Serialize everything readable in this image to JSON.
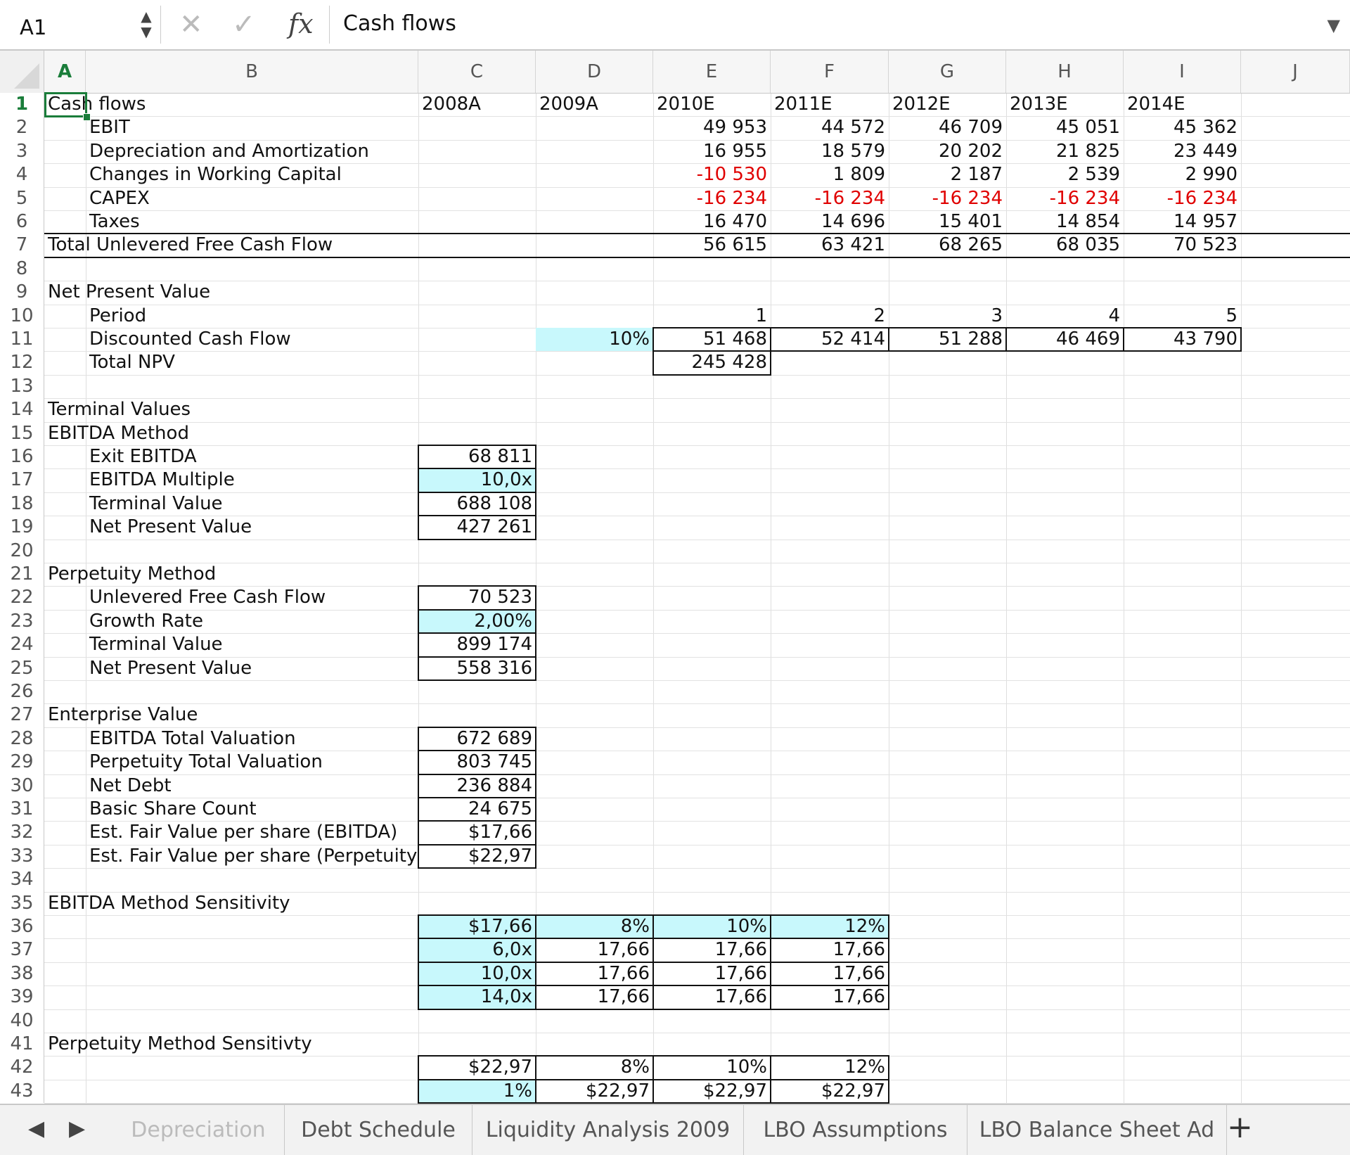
{
  "formula_bar": {
    "cell_ref": "A1",
    "stepper_up": "▲",
    "stepper_down": "▼",
    "cancel_glyph": "✕",
    "enter_glyph": "✓",
    "fx_label": "fx",
    "content": "Cash flows",
    "expand_glyph": "▼"
  },
  "columns": [
    "A",
    "B",
    "C",
    "D",
    "E",
    "F",
    "G",
    "H",
    "I",
    "J"
  ],
  "selected_column": "A",
  "selected_row": 1,
  "rows": [
    {
      "n": "1",
      "cells": [
        [
          "a",
          "Cash flows"
        ],
        [
          "c",
          "2008A"
        ],
        [
          "d",
          "2009A"
        ],
        [
          "e",
          "2010E"
        ],
        [
          "f",
          "2011E"
        ],
        [
          "g",
          "2012E"
        ],
        [
          "h",
          "2013E"
        ],
        [
          "i",
          "2014E"
        ]
      ]
    },
    {
      "n": "2",
      "cells": [
        [
          "b",
          "EBIT"
        ],
        [
          "e",
          "49 953"
        ],
        [
          "f",
          "44 572"
        ],
        [
          "g",
          "46 709"
        ],
        [
          "h",
          "45 051"
        ],
        [
          "i",
          "45 362"
        ]
      ]
    },
    {
      "n": "3",
      "cells": [
        [
          "b",
          "Depreciation and Amortization"
        ],
        [
          "e",
          "16 955"
        ],
        [
          "f",
          "18 579"
        ],
        [
          "g",
          "20 202"
        ],
        [
          "h",
          "21 825"
        ],
        [
          "i",
          "23 449"
        ]
      ]
    },
    {
      "n": "4",
      "cells": [
        [
          "b",
          "Changes in Working Capital"
        ],
        [
          "e",
          "-10 530"
        ],
        [
          "f",
          "1 809"
        ],
        [
          "g",
          "2 187"
        ],
        [
          "h",
          "2 539"
        ],
        [
          "i",
          "2 990"
        ]
      ]
    },
    {
      "n": "5",
      "cells": [
        [
          "b",
          "CAPEX"
        ],
        [
          "e",
          "-16 234"
        ],
        [
          "f",
          "-16 234"
        ],
        [
          "g",
          "-16 234"
        ],
        [
          "h",
          "-16 234"
        ],
        [
          "i",
          "-16 234"
        ]
      ]
    },
    {
      "n": "6",
      "cells": [
        [
          "b",
          "Taxes"
        ],
        [
          "e",
          "16 470"
        ],
        [
          "f",
          "14 696"
        ],
        [
          "g",
          "15 401"
        ],
        [
          "h",
          "14 854"
        ],
        [
          "i",
          "14 957"
        ]
      ]
    },
    {
      "n": "7",
      "cells": [
        [
          "a",
          "Total Unlevered Free Cash Flow"
        ],
        [
          "e",
          "56 615"
        ],
        [
          "f",
          "63 421"
        ],
        [
          "g",
          "68 265"
        ],
        [
          "h",
          "68 035"
        ],
        [
          "i",
          "70 523"
        ]
      ]
    },
    {
      "n": "8",
      "cells": []
    },
    {
      "n": "9",
      "cells": [
        [
          "a",
          "Net Present Value"
        ]
      ]
    },
    {
      "n": "10",
      "cells": [
        [
          "b",
          "Period"
        ],
        [
          "e",
          "1"
        ],
        [
          "f",
          "2"
        ],
        [
          "g",
          "3"
        ],
        [
          "h",
          "4"
        ],
        [
          "i",
          "5"
        ]
      ]
    },
    {
      "n": "11",
      "cells": [
        [
          "b",
          "Discounted Cash Flow"
        ],
        [
          "d",
          "10%"
        ],
        [
          "e",
          "51 468"
        ],
        [
          "f",
          "52 414"
        ],
        [
          "g",
          "51 288"
        ],
        [
          "h",
          "46 469"
        ],
        [
          "i",
          "43 790"
        ]
      ]
    },
    {
      "n": "12",
      "cells": [
        [
          "b",
          "Total NPV"
        ],
        [
          "e",
          "245 428"
        ]
      ]
    },
    {
      "n": "13",
      "cells": []
    },
    {
      "n": "14",
      "cells": [
        [
          "a",
          "Terminal Values"
        ]
      ]
    },
    {
      "n": "15",
      "cells": [
        [
          "a",
          "EBITDA Method"
        ]
      ]
    },
    {
      "n": "16",
      "cells": [
        [
          "b",
          "Exit EBITDA"
        ],
        [
          "c",
          "68 811"
        ]
      ]
    },
    {
      "n": "17",
      "cells": [
        [
          "b",
          "EBITDA Multiple"
        ],
        [
          "c",
          "10,0x"
        ]
      ]
    },
    {
      "n": "18",
      "cells": [
        [
          "b",
          "Terminal Value"
        ],
        [
          "c",
          "688 108"
        ]
      ]
    },
    {
      "n": "19",
      "cells": [
        [
          "b",
          "Net Present Value"
        ],
        [
          "c",
          "427 261"
        ]
      ]
    },
    {
      "n": "20",
      "cells": []
    },
    {
      "n": "21",
      "cells": [
        [
          "a",
          "Perpetuity Method"
        ]
      ]
    },
    {
      "n": "22",
      "cells": [
        [
          "b",
          "Unlevered Free Cash Flow"
        ],
        [
          "c",
          "70 523"
        ]
      ]
    },
    {
      "n": "23",
      "cells": [
        [
          "b",
          "Growth Rate"
        ],
        [
          "c",
          "2,00%"
        ]
      ]
    },
    {
      "n": "24",
      "cells": [
        [
          "b",
          "Terminal Value"
        ],
        [
          "c",
          "899 174"
        ]
      ]
    },
    {
      "n": "25",
      "cells": [
        [
          "b",
          "Net Present Value"
        ],
        [
          "c",
          "558 316"
        ]
      ]
    },
    {
      "n": "26",
      "cells": []
    },
    {
      "n": "27",
      "cells": [
        [
          "a",
          "Enterprise Value"
        ]
      ]
    },
    {
      "n": "28",
      "cells": [
        [
          "b",
          "EBITDA Total Valuation"
        ],
        [
          "c",
          "672 689"
        ]
      ]
    },
    {
      "n": "29",
      "cells": [
        [
          "b",
          "Perpetuity Total Valuation"
        ],
        [
          "c",
          "803 745"
        ]
      ]
    },
    {
      "n": "30",
      "cells": [
        [
          "b",
          "Net Debt"
        ],
        [
          "c",
          "236 884"
        ]
      ]
    },
    {
      "n": "31",
      "cells": [
        [
          "b",
          "Basic Share Count"
        ],
        [
          "c",
          "24 675"
        ]
      ]
    },
    {
      "n": "32",
      "cells": [
        [
          "b",
          "Est. Fair Value per share (EBITDA)"
        ],
        [
          "c",
          "$17,66"
        ]
      ]
    },
    {
      "n": "33",
      "cells": [
        [
          "b",
          "Est. Fair Value per share (Perpetuity"
        ],
        [
          "c",
          "$22,97"
        ]
      ]
    },
    {
      "n": "34",
      "cells": []
    },
    {
      "n": "35",
      "cells": [
        [
          "a",
          "EBITDA Method Sensitivity"
        ]
      ]
    },
    {
      "n": "36",
      "cells": [
        [
          "c",
          "$17,66"
        ],
        [
          "d",
          "8%"
        ],
        [
          "e",
          "10%"
        ],
        [
          "f",
          "12%"
        ]
      ]
    },
    {
      "n": "37",
      "cells": [
        [
          "c",
          "6,0x"
        ],
        [
          "d",
          "17,66"
        ],
        [
          "e",
          "17,66"
        ],
        [
          "f",
          "17,66"
        ]
      ]
    },
    {
      "n": "38",
      "cells": [
        [
          "c",
          "10,0x"
        ],
        [
          "d",
          "17,66"
        ],
        [
          "e",
          "17,66"
        ],
        [
          "f",
          "17,66"
        ]
      ]
    },
    {
      "n": "39",
      "cells": [
        [
          "c",
          "14,0x"
        ],
        [
          "d",
          "17,66"
        ],
        [
          "e",
          "17,66"
        ],
        [
          "f",
          "17,66"
        ]
      ]
    },
    {
      "n": "40",
      "cells": []
    },
    {
      "n": "41",
      "cells": [
        [
          "a",
          "Perpetuity Method Sensitivty"
        ]
      ]
    },
    {
      "n": "42",
      "cells": [
        [
          "c",
          "$22,97"
        ],
        [
          "d",
          "8%"
        ],
        [
          "e",
          "10%"
        ],
        [
          "f",
          "12%"
        ]
      ]
    },
    {
      "n": "43",
      "cells": [
        [
          "c",
          "1%"
        ],
        [
          "d",
          "$22,97"
        ],
        [
          "e",
          "$22,97"
        ],
        [
          "f",
          "$22,97"
        ]
      ]
    }
  ],
  "tabs": {
    "prev_glyph": "◀",
    "next_glyph": "▶",
    "sheets": [
      "Depreciation",
      "Debt Schedule",
      "Liquidity Analysis 2009",
      "LBO Assumptions",
      "LBO Balance Sheet Ad"
    ],
    "add_glyph": "+"
  },
  "colors": {
    "input_fill": "#c8f8fc",
    "negative_text": "#e00000",
    "selection": "#1a7d3a"
  }
}
